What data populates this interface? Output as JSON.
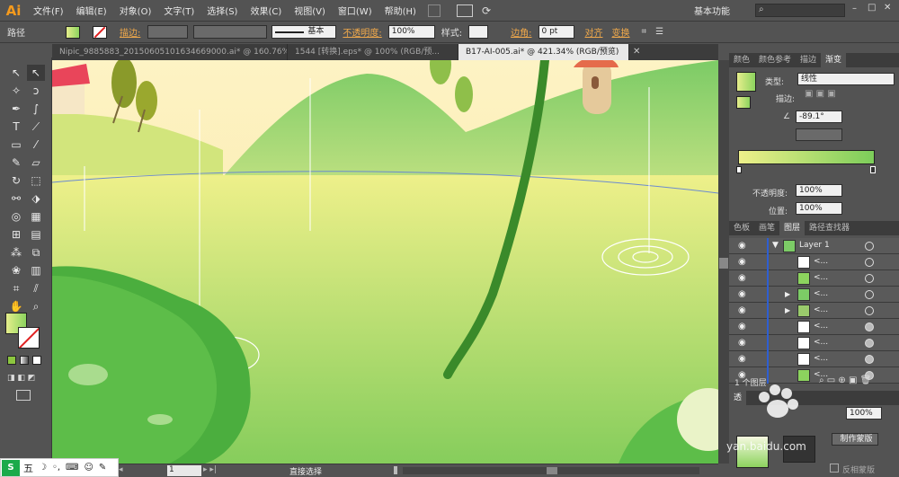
{
  "app": {
    "logo": "Ai",
    "workspace": "基本功能"
  },
  "menu": [
    "文件(F)",
    "编辑(E)",
    "对象(O)",
    "文字(T)",
    "选择(S)",
    "效果(C)",
    "视图(V)",
    "窗口(W)",
    "帮助(H)"
  ],
  "control": {
    "selection_label": "路径",
    "stroke_label": "描边:",
    "stroke_style": "基本",
    "opacity_label": "不透明度:",
    "opacity_value": "100%",
    "style_label": "样式:",
    "corner_label": "边角:",
    "corner_value": "0 pt",
    "align_label": "对齐",
    "transform_label": "变换"
  },
  "tabs": [
    {
      "label": "Nipic_9885883_20150605101634669000.ai* @ 160.76% (RGB/...",
      "active": false
    },
    {
      "label": "1544 [转换].eps* @ 100% (RGB/预...",
      "active": false
    },
    {
      "label": "B17-AI-005.ai* @ 421.34% (RGB/预览)",
      "active": true
    }
  ],
  "panels": {
    "gradient_tabs": [
      "颜色",
      "颜色参考",
      "描边",
      "渐变"
    ],
    "gradient": {
      "type_label": "类型:",
      "type_value": "线性",
      "stroke_label": "描边:",
      "angle_value": "-89.1°",
      "opacity_label": "不透明度:",
      "opacity_value": "100%",
      "location_label": "位置:",
      "location_value": "100%",
      "start_color": "#eef08a",
      "end_color": "#7ccd5a"
    },
    "layer_tabs": [
      "色板",
      "画笔",
      "图层",
      "路径查找器"
    ],
    "layers": [
      {
        "name": "Layer 1",
        "expanded": true
      },
      {
        "name": "<..."
      },
      {
        "name": "<..."
      },
      {
        "name": "<..."
      },
      {
        "name": "<..."
      },
      {
        "name": "<..."
      },
      {
        "name": "<..."
      },
      {
        "name": "<..."
      },
      {
        "name": "<..."
      }
    ],
    "layer_count": "1 个图层",
    "transparency_tab": "透",
    "transparency_value": "100%",
    "make_mask": "制作蒙版",
    "invert_mask": "反相蒙版"
  },
  "status": {
    "zoom_field": "1",
    "tool": "直接选择"
  },
  "ime": {
    "mode": "五"
  },
  "watermark": "yan.baidu.com"
}
